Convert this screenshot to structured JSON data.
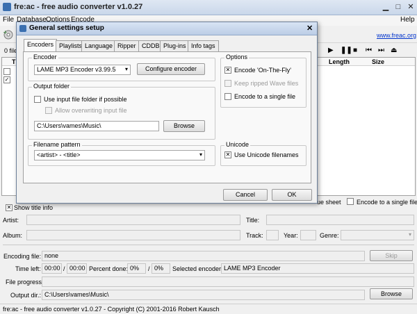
{
  "window": {
    "title": "fre:ac - free audio converter v1.0.27",
    "help": "Help",
    "website": "www.freac.org"
  },
  "menu": [
    "File",
    "Database",
    "Options",
    "Encode"
  ],
  "files": {
    "count_label": "0 file(",
    "col_title": "Ti",
    "col_length": "Length",
    "col_size": "Size"
  },
  "cue": {
    "cue_sheet": "ue sheet",
    "single_file": "Encode to a single file"
  },
  "show_title_info": "Show title info",
  "tags": {
    "artist": "Artist:",
    "title": "Title:",
    "album": "Album:",
    "track": "Track:",
    "year": "Year:",
    "genre": "Genre:"
  },
  "progress": {
    "encoding_file_label": "Encoding file:",
    "encoding_file": "none",
    "skip": "Skip",
    "time_left_label": "Time left:",
    "time_left": "00:00",
    "time_total": "00:00",
    "percent_done_label": "Percent done:",
    "percent_a": "0%",
    "percent_b": "0%",
    "selected_encoder_label": "Selected encoder:",
    "selected_encoder": "LAME MP3 Encoder",
    "file_progress_label": "File progress:",
    "output_dir_label": "Output dir.:",
    "output_dir": "C:\\Users\\vames\\Music\\",
    "browse": "Browse"
  },
  "status": "fre:ac - free audio converter v1.0.27 - Copyright (C) 2001-2016 Robert Kausch",
  "dialog": {
    "title": "General settings setup",
    "tabs": [
      "Encoders",
      "Playlists",
      "Language",
      "Ripper",
      "CDDB",
      "Plug-ins",
      "Info tags"
    ],
    "encoder_group": "Encoder",
    "encoder_value": "LAME MP3 Encoder v3.99.5",
    "configure_encoder": "Configure encoder",
    "output_group": "Output folder",
    "use_input_folder": "Use input file folder if possible",
    "allow_overwrite": "Allow overwriting input file",
    "output_path": "C:\\Users\\vames\\Music\\",
    "browse": "Browse",
    "filename_group": "Filename pattern",
    "filename_pattern": "<artist> - <title>",
    "options_group": "Options",
    "encode_on_the_fly": "Encode 'On-The-Fly'",
    "keep_ripped": "Keep ripped Wave files",
    "encode_single": "Encode to a single file",
    "unicode_group": "Unicode",
    "use_unicode": "Use Unicode filenames",
    "cancel": "Cancel",
    "ok": "OK"
  }
}
